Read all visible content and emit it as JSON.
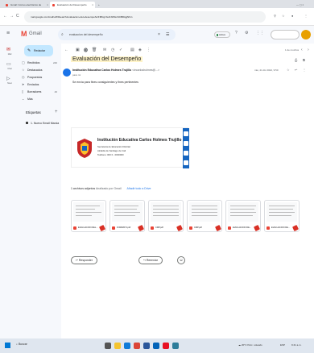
{
  "browser": {
    "tabs": [
      {
        "title": "Gmail: Correo electrónico de",
        "favicon_color": "#ea4335"
      },
      {
        "title": "Evaluación del Desempeño",
        "favicon_color": "#ea4335"
      }
    ],
    "new_tab": "+",
    "url": "mail.google.com/mail/u/0/#search/evaluacion+del+desempeño/FMfcgzGxZJZDsvSCBDkjgNfnn",
    "controls": {
      "back": "←",
      "forward": "→",
      "reload": "C"
    }
  },
  "gmail": {
    "header": {
      "app_name": "Gmail",
      "search_value": "evaluacion del desempeño",
      "status_label": "Activo",
      "status_color": "#188038"
    },
    "rail": [
      {
        "icon": "mail-icon",
        "label": "Mail"
      },
      {
        "icon": "chat-icon",
        "label": "Chat"
      },
      {
        "icon": "meet-icon",
        "label": "Meet"
      }
    ],
    "nav": {
      "compose": "Redactar",
      "items": [
        {
          "label": "Recibidos",
          "count": "240",
          "icon": "inbox-icon",
          "active": false
        },
        {
          "label": "Destacados",
          "count": "",
          "icon": "star-icon",
          "active": false
        },
        {
          "label": "Pospuestos",
          "count": "",
          "icon": "clock-icon",
          "active": false
        },
        {
          "label": "Enviados",
          "count": "",
          "icon": "send-icon",
          "active": false
        },
        {
          "label": "Borradores",
          "count": "46",
          "icon": "draft-icon",
          "active": false
        },
        {
          "label": "Más",
          "count": "",
          "icon": "chevron-down-icon",
          "active": false
        }
      ],
      "labels_title": "Etiquetas",
      "labels": [
        "1. Nuevo Email Marcia"
      ]
    },
    "message": {
      "subject": "Evaluación del Desempeño",
      "pager": "1 de muchos",
      "sender_name": "Institución Educativa Carlos Holmes Trujillo",
      "sender_email": "<iecarlosholmes@...>",
      "to": "para mí",
      "date": "mié, 21 dic 2022, 9:50",
      "body": "Se envía para fines consiguientes y fines pertinentes",
      "signature": {
        "title": "Institución Educativa Carlos Holmes Trujillo",
        "lines": [
          "Secretaría de Educación Distrital",
          "Alcaldía de Santiago de Cali",
          "Teléfono: 000 0 - 0000000"
        ],
        "bar_color": "#1565c0"
      },
      "attachments_header": "1 archivos adjuntos",
      "attachments_scan": "Analizado por Gmail",
      "attachments_drive": "Añadir todo a Drive",
      "attachments": [
        {
          "name": "EVALUACION DEL..."
        },
        {
          "name": "FORMATO.pdf"
        },
        {
          "name": "CMP.pdf"
        },
        {
          "name": "CMP.pdf"
        },
        {
          "name": "EVALUACION DE..."
        },
        {
          "name": "EVALUACION DE..."
        }
      ],
      "reply_label": "Responder",
      "forward_label": "Reenviar",
      "emoji": "☺"
    }
  },
  "taskbar": {
    "search": "Buscar",
    "weather": "20°C Parc. soleado",
    "language": "ESP",
    "time": "9:41 a.m."
  }
}
